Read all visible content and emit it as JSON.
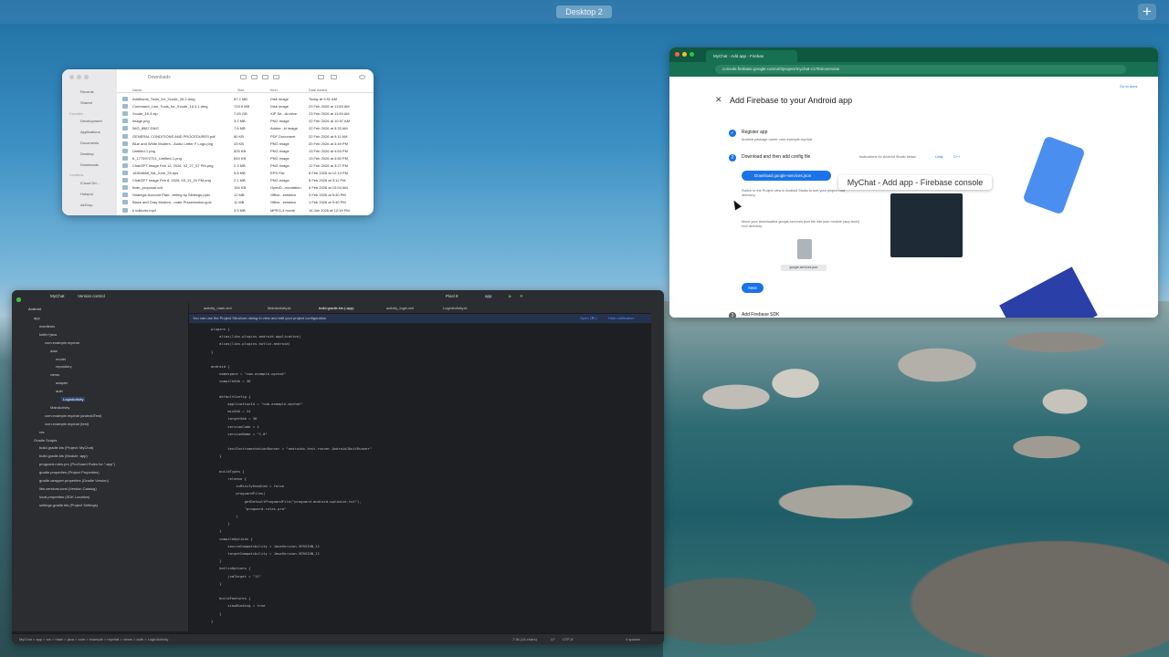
{
  "desktop": {
    "space_label": "Desktop 2",
    "add_label": "+"
  },
  "finder": {
    "title": "Downloads",
    "sidebar": {
      "favorites": [
        "Recents",
        "Shared"
      ],
      "favorites_header": "Favorites",
      "places": [
        "Development",
        "Applications",
        "Documents",
        "Desktop",
        "Downloads"
      ],
      "locations_header": "Locations",
      "locations": [
        "iCloud Dri...",
        "Hotspot",
        "AirDrop"
      ]
    },
    "columns": {
      "name": "Name",
      "size": "Size",
      "kind": "Kind",
      "date": "Date Added"
    },
    "files": [
      {
        "name": "Additional_Tools_for_Xcode_26.2.dmg",
        "size": "87.2 MB",
        "kind": "Disk Image",
        "date": "Today at 9:51 AM"
      },
      {
        "name": "Command_Line_Tools_for_Xcode_16.3.1.dmg",
        "size": "729.5 MB",
        "kind": "Disk Image",
        "date": "23 Feb 2026 at 11:59 AM"
      },
      {
        "name": "Xcode_16.3.xip",
        "size": "7.63 GB",
        "kind": "XIP Se...Archive",
        "date": "23 Feb 2026 at 11:59 AM"
      },
      {
        "name": "image.png",
        "size": "3.2 MB",
        "kind": "PNG image",
        "date": "22 Feb 2026 at 10:57 AM"
      },
      {
        "name": "IMG_8987.DNG",
        "size": "7.6 MB",
        "kind": "Adobe...ki image",
        "date": "22 Feb 2026 at 9:33 AM"
      },
      {
        "name": "GENERAL CONDITIONS AND PROCEDURES.pdf",
        "size": "80 KB",
        "kind": "PDF Document",
        "date": "22 Feb 2026 at 9:11 AM"
      },
      {
        "name": "Blue and White Modern...Audio Letter F Logo.png",
        "size": "43 KB",
        "kind": "PNG image",
        "date": "20 Feb 2026 at 3:49 PM"
      },
      {
        "name": "Untitled-1.png",
        "size": "525 KB",
        "kind": "PNG image",
        "date": "13 Feb 2026 at 4:53 PM"
      },
      {
        "name": "6_1770972721_Untitled-1.png",
        "size": "649 KB",
        "kind": "PNG image",
        "date": "13 Feb 2026 at 4:50 PM"
      },
      {
        "name": "ChatGPT Image Feb 12, 2026, 03_27_07 PM.png",
        "size": "2.3 MB",
        "kind": "PNG image",
        "date": "12 Feb 2026 at 3:27 PM"
      },
      {
        "name": "18304688_Na_June_25.eps",
        "size": "5.8 MB",
        "kind": "EPS File",
        "date": "8 Feb 2026 at 12:14 PM"
      },
      {
        "name": "ChatGPT Image Feb 8, 2026, 03_11_20 PM.png",
        "size": "2.1 MB",
        "kind": "PNG image",
        "date": "8 Feb 2026 at 3:11 PM"
      },
      {
        "name": "fizah_proposal.odt",
        "size": "154 KB",
        "kind": "OpenD...mentation",
        "date": "6 Feb 2026 at 10:54 AM"
      },
      {
        "name": "Strategic Account Plan...eeting by Slidesgo.pptx",
        "size": "12 MB",
        "kind": "Office...entation",
        "date": "3 Feb 2026 at 5:40 PM"
      },
      {
        "name": "Black and Gray Modern...orate Presentation.pptx",
        "size": "11 MB",
        "kind": "Office...entation",
        "date": "1 Feb 2026 at 9:40 PM"
      },
      {
        "name": "b kdtechs.mp4",
        "size": "3.5 MB",
        "kind": "MPEG-4 movie",
        "date": "16 Jan 2026 at 12:19 PM"
      }
    ]
  },
  "browser": {
    "tab_title": "MyChat - Add app - Firebas",
    "url": "console.firebase.google.com/u/0/project/mychat-c1784/overview",
    "page_title": "Add Firebase to your Android app",
    "go_to_docs": "Go to docs",
    "steps": [
      {
        "num": "✓",
        "label": "Register app",
        "sub": "Android package name: com.example.mychat"
      },
      {
        "num": "2",
        "label": "Download and then add config file",
        "sub": ""
      },
      {
        "num": "3",
        "label": "Add Firebase SDK",
        "sub": ""
      }
    ],
    "instructions_link": "Instructions for Android Studio below",
    "unity_label": "Unity",
    "cpp_label": "C++",
    "download_button": "Download google-services.json",
    "switch_text": "Switch to the Project view in Android Studio to see your project root directory.",
    "move_text": "Move your downloaded google-services.json file into your module (app-level) root directory.",
    "file_caption": "google-services.json",
    "next_button": "Next",
    "tooltip": "MyChat - Add app - Firebase console"
  },
  "ide": {
    "project_name": "MyChat",
    "vcs": "Version control",
    "device": "Pixel 8",
    "run_config": "app",
    "view_mode": "Android",
    "tree": [
      {
        "label": "app",
        "indent": 1
      },
      {
        "label": "manifests",
        "indent": 2
      },
      {
        "label": "kotlin+java",
        "indent": 2
      },
      {
        "label": "com.example.mychat",
        "indent": 3
      },
      {
        "label": "data",
        "indent": 4
      },
      {
        "label": "model",
        "indent": 5
      },
      {
        "label": "repository",
        "indent": 5
      },
      {
        "label": "views",
        "indent": 4
      },
      {
        "label": "adapter",
        "indent": 5
      },
      {
        "label": "auth",
        "indent": 5
      },
      {
        "label": "LoginActivity",
        "indent": 6
      },
      {
        "label": "MainActivity",
        "indent": 4
      },
      {
        "label": "com.example.mychat (androidTest)",
        "indent": 3
      },
      {
        "label": "com.example.mychat (test)",
        "indent": 3
      },
      {
        "label": "res",
        "indent": 2
      },
      {
        "label": "Gradle Scripts",
        "indent": 1
      },
      {
        "label": "build.gradle.kts (Project: MyChat)",
        "indent": 2
      },
      {
        "label": "build.gradle.kts (Module :app)",
        "indent": 2
      },
      {
        "label": "proguard-rules.pro (ProGuard Rules for \":app\")",
        "indent": 2
      },
      {
        "label": "gradle.properties (Project Properties)",
        "indent": 2
      },
      {
        "label": "gradle-wrapper.properties (Gradle Version)",
        "indent": 2
      },
      {
        "label": "libs.versions.toml (Version Catalog)",
        "indent": 2
      },
      {
        "label": "local.properties (SDK Location)",
        "indent": 2
      },
      {
        "label": "settings.gradle.kts (Project Settings)",
        "indent": 2
      }
    ],
    "tabs": [
      "activity_main.xml",
      "MainActivity.kt",
      "build.gradle.kts (:app)",
      "activity_login.xml",
      "LoginActivity.kt"
    ],
    "banner": "You can use the Project Structure dialog to view and edit your project configuration",
    "banner_open": "Open (⌘;)",
    "banner_hide": "Hide notification",
    "status_path": "MyChat > app > src > main > java > com > example > mychat > views > auth > LoginActivity",
    "status_pos": "7:36 (16 chars)",
    "status_lf": "LF",
    "status_enc": "UTF-8",
    "status_indent": "4 spaces",
    "code": [
      "plugins {",
      "    alias(libs.plugins.android.application)",
      "    alias(libs.plugins.kotlin.android)",
      "}",
      "",
      "android {",
      "    namespace = \"com.example.mychat\"",
      "    compileSdk = 36",
      "",
      "    defaultConfig {",
      "        applicationId = \"com.example.mychat\"",
      "        minSdk = 24",
      "        targetSdk = 36",
      "        versionCode = 1",
      "        versionName = \"1.0\"",
      "",
      "        testInstrumentationRunner = \"androidx.test.runner.AndroidJUnitRunner\"",
      "    }",
      "",
      "    buildTypes {",
      "        release {",
      "            isMinifyEnabled = false",
      "            proguardFiles(",
      "                getDefaultProguardFile(\"proguard-android-optimize.txt\"),",
      "                \"proguard-rules.pro\"",
      "            )",
      "        }",
      "    }",
      "    compileOptions {",
      "        sourceCompatibility = JavaVersion.VERSION_11",
      "        targetCompatibility = JavaVersion.VERSION_11",
      "    }",
      "    kotlinOptions {",
      "        jvmTarget = \"11\"",
      "    }",
      "",
      "    buildFeatures {",
      "        viewBinding = true",
      "    }",
      "}"
    ]
  }
}
